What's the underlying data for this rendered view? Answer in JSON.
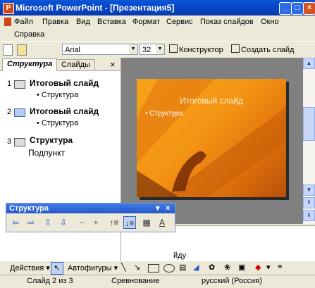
{
  "window": {
    "title": "Microsoft PowerPoint - [Презентация5]",
    "app_icon_letter": "P"
  },
  "menu": {
    "items": [
      "Файл",
      "Правка",
      "Вид",
      "Вставка",
      "Формат",
      "Сервис",
      "Показ слайдов",
      "Окно",
      "Справка"
    ],
    "help_hint": "?"
  },
  "toolbar": {
    "font_name": "Arial",
    "font_size": "32",
    "designer_label": "Конструктор",
    "new_slide_label": "Создать слайд"
  },
  "outline_pane": {
    "tabs": [
      "Структура",
      "Слайды"
    ],
    "close_label": "×",
    "slides": [
      {
        "number": "1",
        "title": "Итоговый слайд",
        "bullets": [
          "Структура"
        ]
      },
      {
        "number": "2",
        "title": "Итоговый слайд",
        "bullets": [
          "Структура"
        ]
      },
      {
        "number": "3",
        "title": "Структура",
        "bullets": [
          "Подпункт"
        ]
      }
    ]
  },
  "slide": {
    "title": "Итоговый слайд",
    "bullet": "Структура",
    "colors": {
      "background": "#f49414",
      "shadow": "#b8500a"
    }
  },
  "notes": {
    "partial_text": "йду"
  },
  "outline_toolbar": {
    "title": "Структура"
  },
  "drawing_toolbar": {
    "actions_label": "Действия",
    "autoshapes_label": "Автофигуры"
  },
  "status": {
    "slide_info": "Слайд 2 из 3",
    "design": "Сревнование",
    "language": "русский (Россия)"
  },
  "colors": {
    "titlebar": "#0548c8",
    "chrome": "#ece9d8",
    "accent": "#316ac5"
  }
}
